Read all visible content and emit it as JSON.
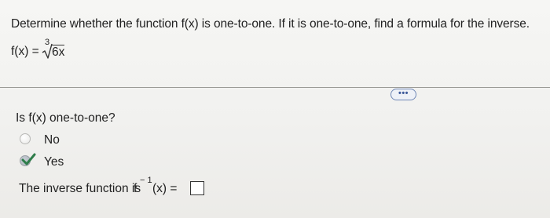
{
  "question": {
    "text": "Determine whether the function f(x) is one-to-one. If it is one-to-one, find a formula for the inverse."
  },
  "formula": {
    "lhs": "f(x) =",
    "root_index": "3",
    "radicand": "6x"
  },
  "more_button": {
    "label": "•••"
  },
  "part1": {
    "prompt": "Is f(x) one-to-one?",
    "options": [
      {
        "label": "No",
        "selected": false
      },
      {
        "label": "Yes",
        "selected": true
      }
    ]
  },
  "part2": {
    "prompt": "The inverse function is",
    "function_name": "f",
    "superscript": "− 1",
    "argument": "(x) =",
    "answer_value": ""
  },
  "colors": {
    "accent": "#3d5a9a",
    "check_green": "#2e7d4a"
  }
}
